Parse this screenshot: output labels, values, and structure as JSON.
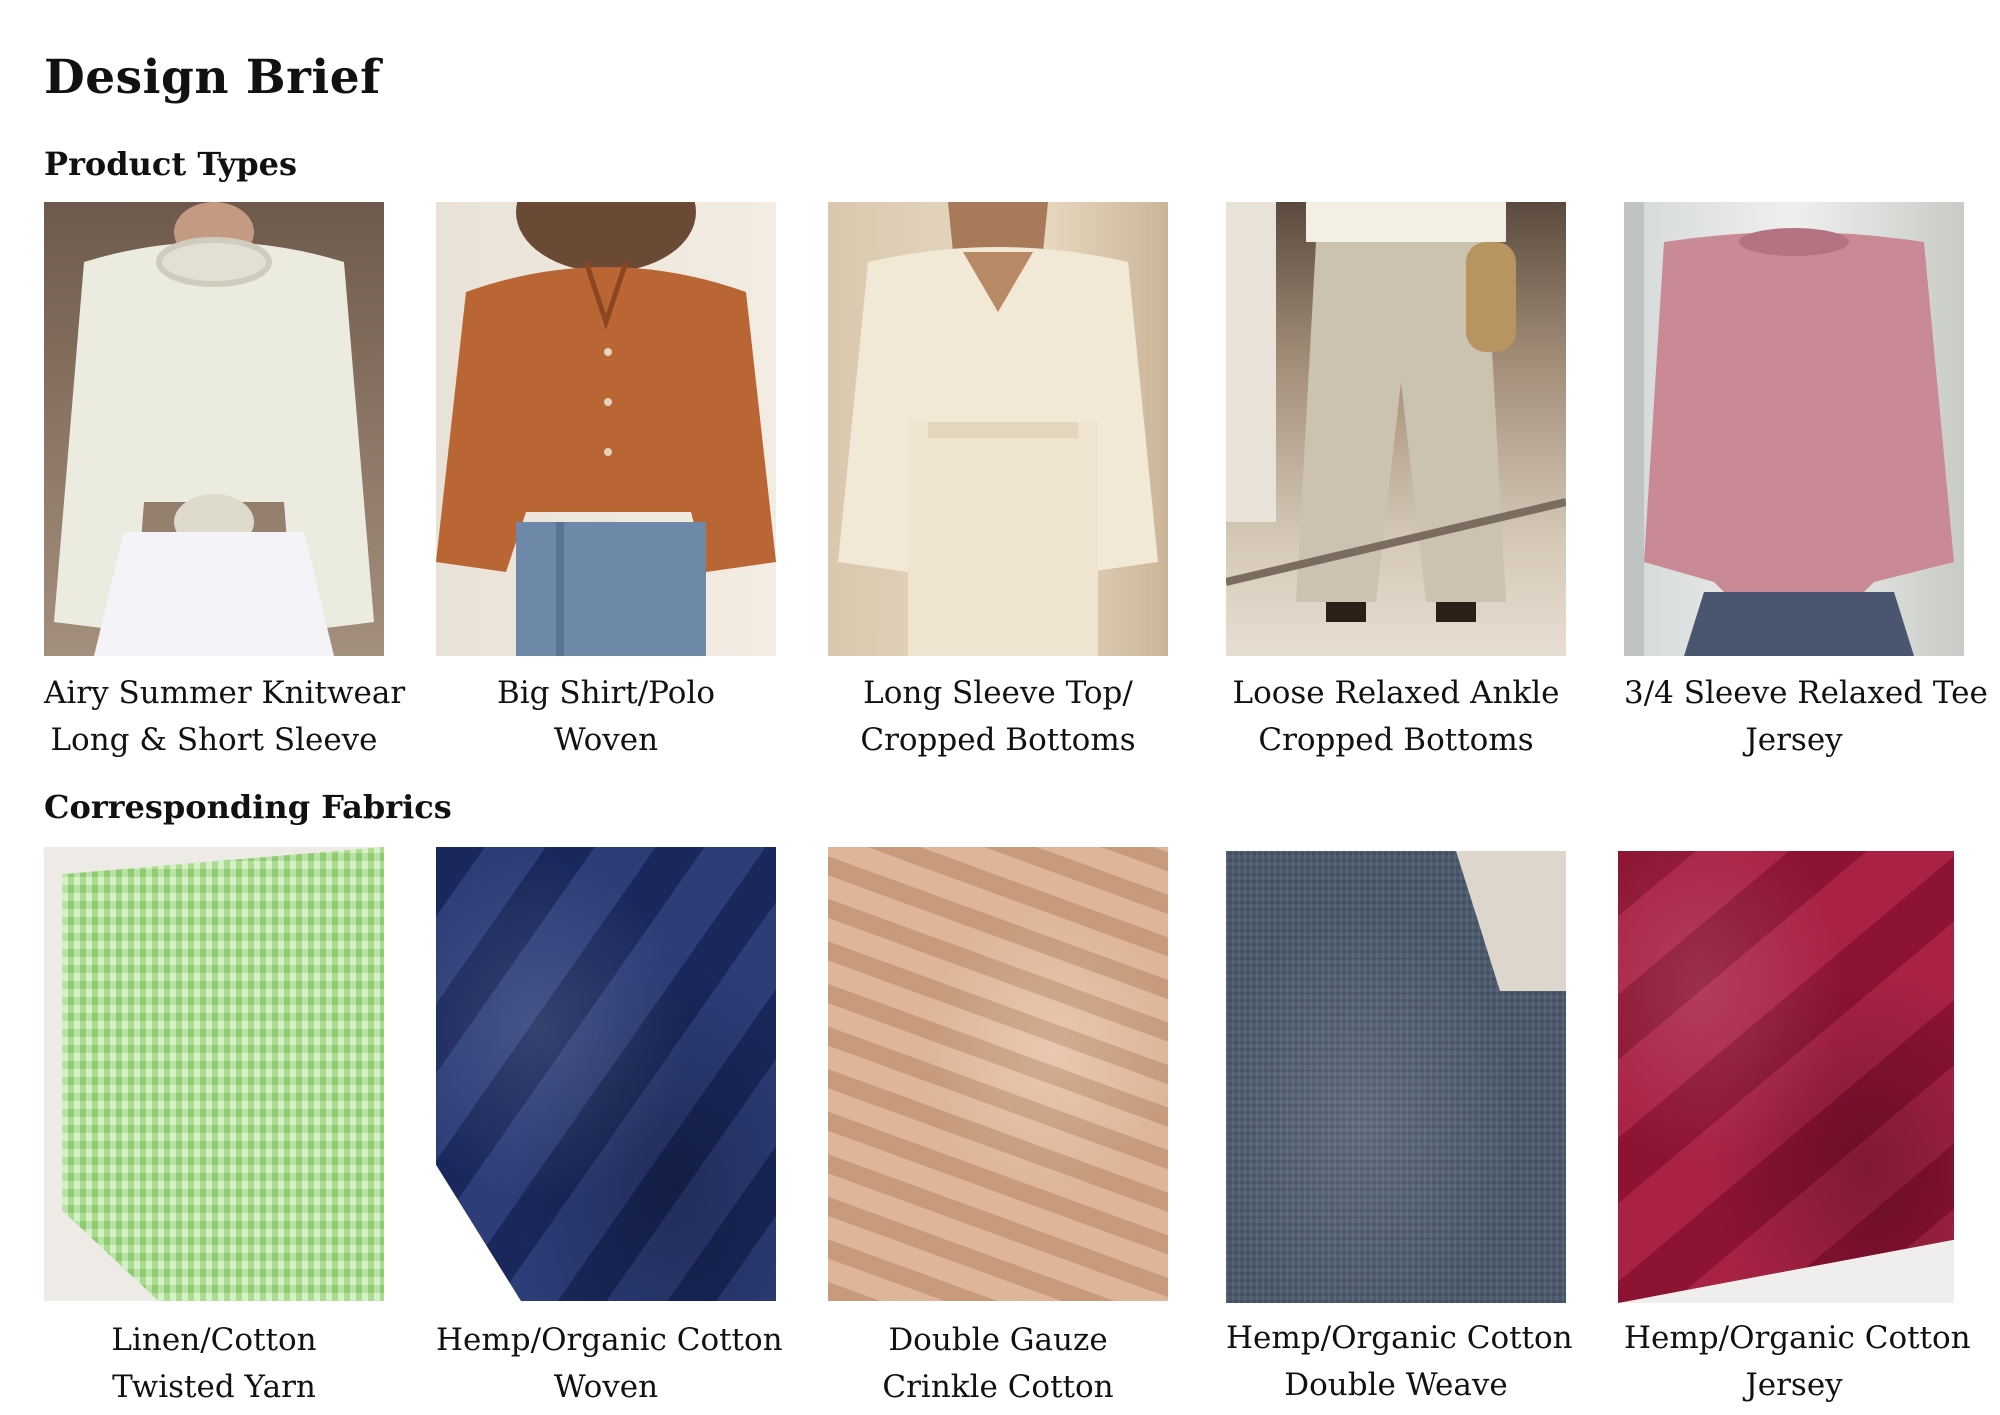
{
  "title": "Design Brief",
  "sections": {
    "products": "Product Types",
    "fabrics": "Corresponding Fabrics"
  },
  "products": [
    {
      "line1": "Airy Summer Knitwear",
      "line2": "Long & Short Sleeve"
    },
    {
      "line1": "Big Shirt/Polo",
      "line2": "Woven"
    },
    {
      "line1": "Long Sleeve Top/",
      "line2": "Cropped Bottoms"
    },
    {
      "line1": "Loose Relaxed Ankle",
      "line2": "Cropped Bottoms"
    },
    {
      "line1": "3/4 Sleeve Relaxed Tee",
      "line2": "Jersey"
    }
  ],
  "fabrics": [
    {
      "line1": "Linen/Cotton",
      "line2": "Twisted Yarn",
      "color": "#a8e38a"
    },
    {
      "line1": "Hemp/Organic Cotton",
      "line2": "Woven",
      "color": "#1f3170"
    },
    {
      "line1": "Double Gauze",
      "line2": "Crinkle Cotton",
      "color": "#d8ab8c"
    },
    {
      "line1": "Hemp/Organic Cotton",
      "line2": "Double Weave",
      "color": "#4c5a6e"
    },
    {
      "line1": "Hemp/Organic Cotton",
      "line2": "Jersey",
      "color": "#a4163a"
    }
  ]
}
